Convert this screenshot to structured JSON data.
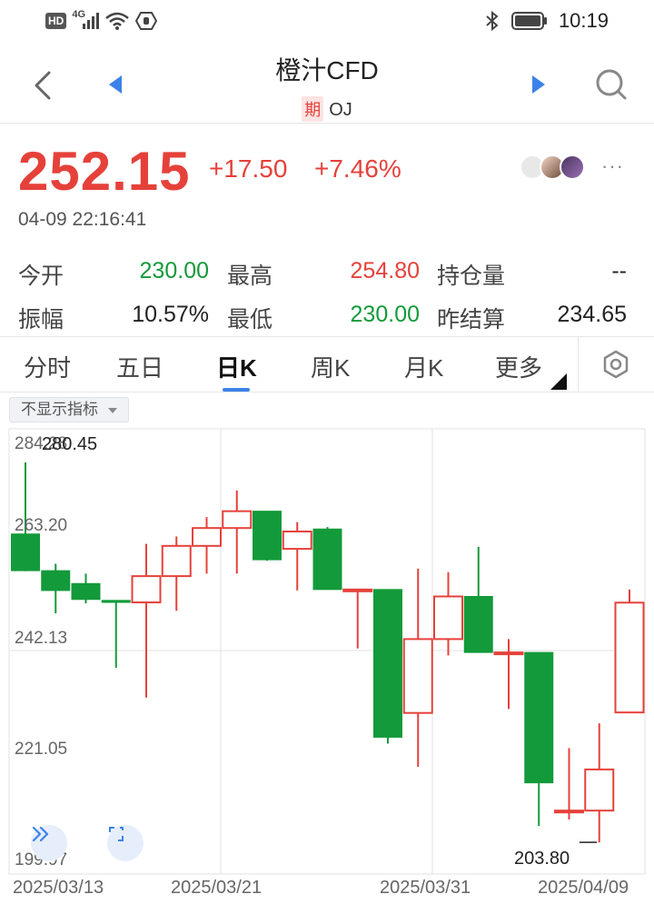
{
  "status_bar": {
    "hd": "HD",
    "network": "4G",
    "time": "10:19"
  },
  "nav": {
    "title": "橙汁CFD",
    "badge": "期",
    "code": "OJ"
  },
  "quote": {
    "price": "252.15",
    "change": "+17.50",
    "change_pct": "+7.46%",
    "time": "04-09 22:16:41",
    "more": "···"
  },
  "stats": {
    "open_label": "今开",
    "open_value": "230.00",
    "high_label": "最高",
    "high_value": "254.80",
    "oi_label": "持仓量",
    "oi_value": "--",
    "amp_label": "振幅",
    "amp_value": "10.57%",
    "low_label": "最低",
    "low_value": "230.00",
    "prev_label": "昨结算",
    "prev_value": "234.65"
  },
  "tabs": [
    "分时",
    "五日",
    "日K",
    "周K",
    "月K",
    "更多"
  ],
  "active_tab": "日K",
  "indicator_button": "不显示指标",
  "colors": {
    "up": "#e5413a",
    "down": "#139a3a",
    "accent": "#3b82e8"
  },
  "chart_data": {
    "type": "candlestick",
    "y_ticks": [
      "284.28",
      "263.20",
      "242.13",
      "221.05",
      "199.97"
    ],
    "x_ticks": [
      "2025/03/13",
      "2025/03/21",
      "2025/03/31",
      "2025/04/09"
    ],
    "ylim": [
      199.97,
      284.28
    ],
    "max_label": "280.45",
    "min_label": "203.80",
    "candles": [
      {
        "o": 266.0,
        "h": 280.45,
        "l": 258.5,
        "c": 258.6
      },
      {
        "o": 258.6,
        "h": 260.0,
        "l": 250.0,
        "c": 254.6
      },
      {
        "o": 256.0,
        "h": 258.0,
        "l": 252.0,
        "c": 252.8
      },
      {
        "o": 252.6,
        "h": 252.6,
        "l": 239.0,
        "c": 252.2
      },
      {
        "o": 252.2,
        "h": 264.0,
        "l": 233.0,
        "c": 257.5
      },
      {
        "o": 257.5,
        "h": 265.5,
        "l": 250.5,
        "c": 263.6
      },
      {
        "o": 263.6,
        "h": 269.4,
        "l": 258.0,
        "c": 267.2
      },
      {
        "o": 267.2,
        "h": 274.8,
        "l": 258.0,
        "c": 270.6
      },
      {
        "o": 270.6,
        "h": 270.6,
        "l": 260.6,
        "c": 260.8
      },
      {
        "o": 263.0,
        "h": 268.4,
        "l": 254.6,
        "c": 266.5
      },
      {
        "o": 267.0,
        "h": 267.4,
        "l": 254.8,
        "c": 254.8
      },
      {
        "o": 254.8,
        "h": 254.8,
        "l": 242.9,
        "c": 254.8
      },
      {
        "o": 254.8,
        "h": 254.8,
        "l": 223.7,
        "c": 225.0
      },
      {
        "o": 229.9,
        "h": 259.0,
        "l": 219.0,
        "c": 244.8
      },
      {
        "o": 244.8,
        "h": 258.3,
        "l": 241.5,
        "c": 253.4
      },
      {
        "o": 253.4,
        "h": 263.4,
        "l": 242.1,
        "c": 242.1
      },
      {
        "o": 242.1,
        "h": 244.8,
        "l": 230.7,
        "c": 242.1
      },
      {
        "o": 242.1,
        "h": 242.1,
        "l": 207.1,
        "c": 215.8
      },
      {
        "o": 210.2,
        "h": 222.8,
        "l": 208.4,
        "c": 210.2
      },
      {
        "o": 210.2,
        "h": 227.8,
        "l": 203.8,
        "c": 218.5
      },
      {
        "o": 230.0,
        "h": 254.8,
        "l": 230.0,
        "c": 252.15
      }
    ]
  }
}
